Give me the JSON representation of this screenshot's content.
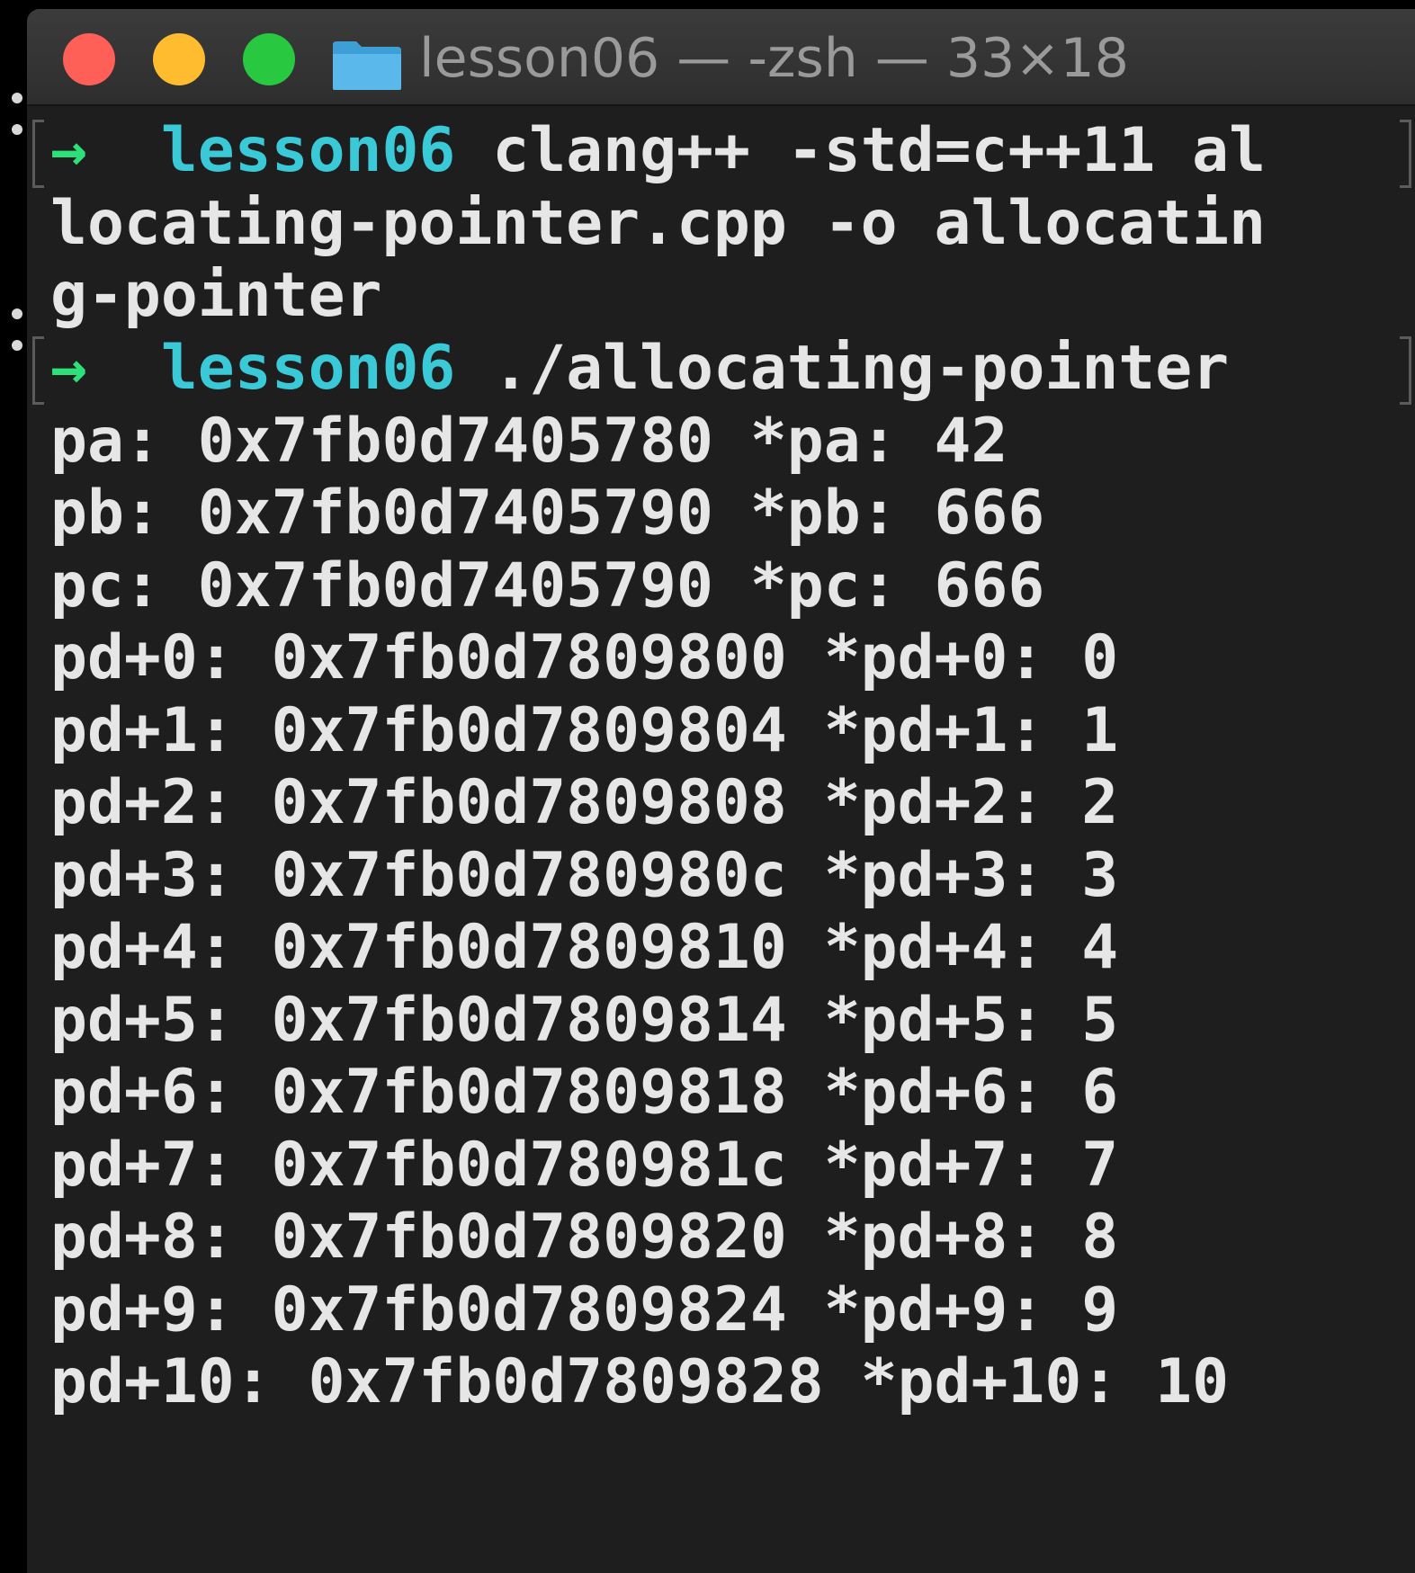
{
  "window": {
    "title": "lesson06 — -zsh — 33×18"
  },
  "colors": {
    "close": "#fe5f57",
    "minimize": "#febc2e",
    "maximize": "#28c840",
    "prompt_arrow": "#2ee07a",
    "prompt_dir": "#3ac9d6",
    "text": "#e6e6e6",
    "background": "#1e1e1e"
  },
  "icons": {
    "folder": "folder-icon",
    "prompt": "arrow-right-icon"
  },
  "terminal": {
    "prompt_arrow": "→",
    "prompt_dir": "lesson06",
    "command1_part1": "clang++ -std=c++11 al",
    "command1_part2": "locating-pointer.cpp -o allocatin",
    "command1_part3": "g-pointer",
    "command2": "./allocating-pointer",
    "output": [
      "pa: 0x7fb0d7405780 *pa: 42",
      "pb: 0x7fb0d7405790 *pb: 666",
      "pc: 0x7fb0d7405790 *pc: 666",
      "pd+0: 0x7fb0d7809800 *pd+0: 0",
      "pd+1: 0x7fb0d7809804 *pd+1: 1",
      "pd+2: 0x7fb0d7809808 *pd+2: 2",
      "pd+3: 0x7fb0d780980c *pd+3: 3",
      "pd+4: 0x7fb0d7809810 *pd+4: 4",
      "pd+5: 0x7fb0d7809814 *pd+5: 5",
      "pd+6: 0x7fb0d7809818 *pd+6: 6",
      "pd+7: 0x7fb0d780981c *pd+7: 7",
      "pd+8: 0x7fb0d7809820 *pd+8: 8",
      "pd+9: 0x7fb0d7809824 *pd+9: 9",
      "pd+10: 0x7fb0d7809828 *pd+10: 10"
    ]
  }
}
